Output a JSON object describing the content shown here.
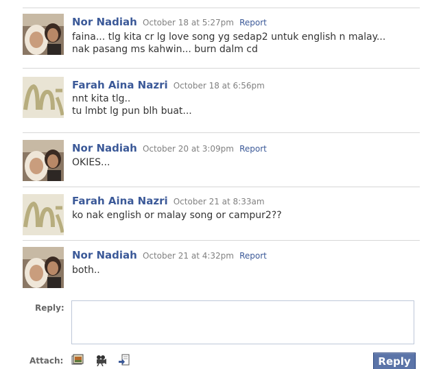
{
  "comments": [
    {
      "author": "Nor Nadiah",
      "date": "October 18 at 5:27pm",
      "report": "Report",
      "lines": [
        "faina... tlg kita cr lg love song yg sedap2 untuk english n malay...",
        "nak pasang ms kahwin... burn dalm cd"
      ]
    },
    {
      "author": "Farah Aina Nazri",
      "date": "October 18 at 6:56pm",
      "lines": [
        "nnt kita tlg..",
        "tu lmbt lg pun blh buat..."
      ]
    },
    {
      "author": "Nor Nadiah",
      "date": "October 20 at 3:09pm",
      "report": "Report",
      "lines": [
        "OKIES..."
      ]
    },
    {
      "author": "Farah Aina Nazri",
      "date": "October 21 at 8:33am",
      "lines": [
        "ko nak english or malay song or campur2??"
      ]
    },
    {
      "author": "Nor Nadiah",
      "date": "October 21 at 4:32pm",
      "report": "Report",
      "lines": [
        "both.."
      ]
    }
  ],
  "reply_form": {
    "reply_label": "Reply:",
    "reply_value": "",
    "attach_label": "Attach:",
    "attach_icons": [
      "photo-icon",
      "video-icon",
      "link-icon"
    ],
    "submit_label": "Reply"
  },
  "colors": {
    "link": "#3b5998",
    "date": "#808080",
    "button": "#5b74a8"
  }
}
